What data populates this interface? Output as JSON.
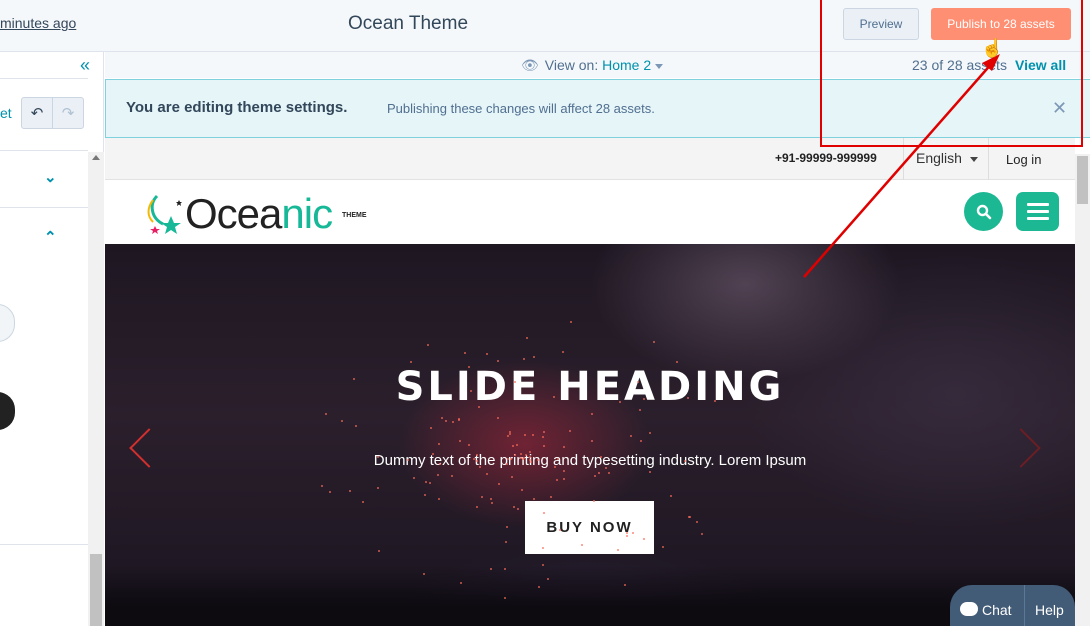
{
  "topbar": {
    "saved_text": "minutes ago",
    "title": "Ocean Theme",
    "preview_label": "Preview",
    "publish_label": "Publish to 28 assets"
  },
  "left_panel": {
    "reset_text": "et",
    "collapse_icon": "double-chevron-left-icon",
    "undo_icon": "undo-icon",
    "redo_icon": "redo-icon"
  },
  "viewbar": {
    "view_on_label": "View on:",
    "selected_page": "Home 2",
    "asset_count": "23 of 28 assets",
    "view_all_label": "View all"
  },
  "alert": {
    "title": "You are editing theme settings.",
    "message": "Publishing these changes will affect 28 assets."
  },
  "site": {
    "phone": "+91-99999-999999",
    "language": "English",
    "login": "Log in",
    "logo_text_dark": "Ocea",
    "logo_text_teal": "nic",
    "logo_tag": "THEME",
    "hero_heading": "SLIDE HEADING",
    "hero_text": "Dummy text of the printing and typesetting industry. Lorem Ipsum",
    "buy_button": "BUY NOW"
  },
  "chat": {
    "chat_label": "Chat",
    "help_label": "Help"
  },
  "colors": {
    "accent": "#0091ae",
    "publish": "#ff8f73",
    "brand_teal": "#1cb894",
    "annotation": "#e00000"
  }
}
